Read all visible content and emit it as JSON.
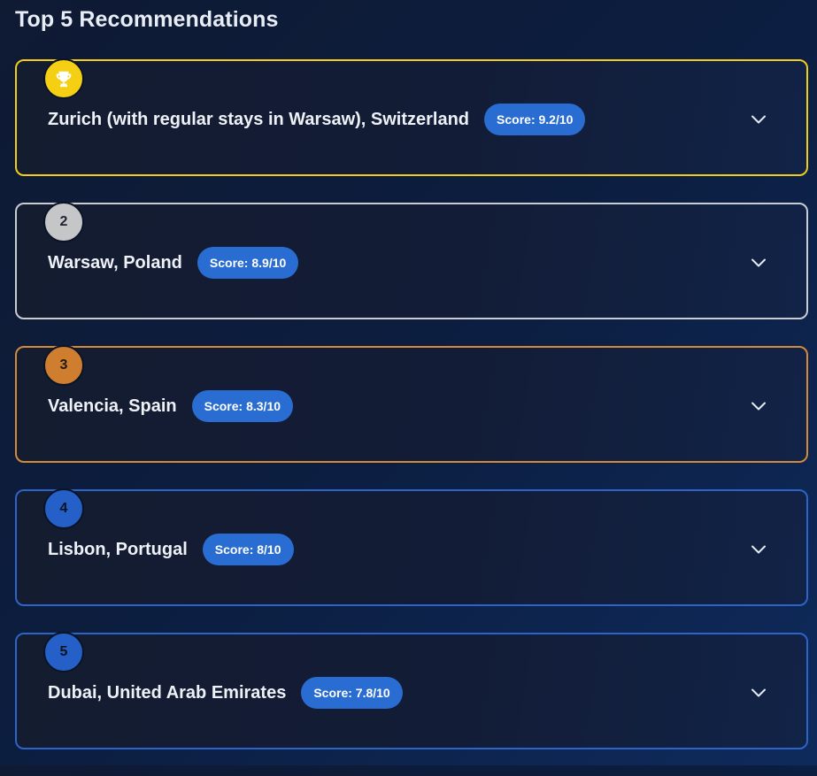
{
  "page": {
    "title": "Top 5 Recommendations"
  },
  "recommendations": [
    {
      "rank": "1",
      "rank_icon": "trophy-icon",
      "city": "Zurich (with regular stays in Warsaw), Switzerland",
      "score": "Score: 9.2/10",
      "accent": "#f2cc17"
    },
    {
      "rank": "2",
      "city": "Warsaw, Poland",
      "score": "Score: 8.9/10",
      "accent": "#c9ccd1"
    },
    {
      "rank": "3",
      "city": "Valencia, Spain",
      "score": "Score: 8.3/10",
      "accent": "#d38a3b"
    },
    {
      "rank": "4",
      "city": "Lisbon, Portugal",
      "score": "Score: 8/10",
      "accent": "#2c64c9"
    },
    {
      "rank": "5",
      "city": "Dubai, United Arab Emirates",
      "score": "Score: 7.8/10",
      "accent": "#2c64c9"
    }
  ],
  "icons": {
    "expand": "chevron-down-icon"
  },
  "colors": {
    "score_pill": "#2a6dd2",
    "background": "#0c1d3e"
  }
}
